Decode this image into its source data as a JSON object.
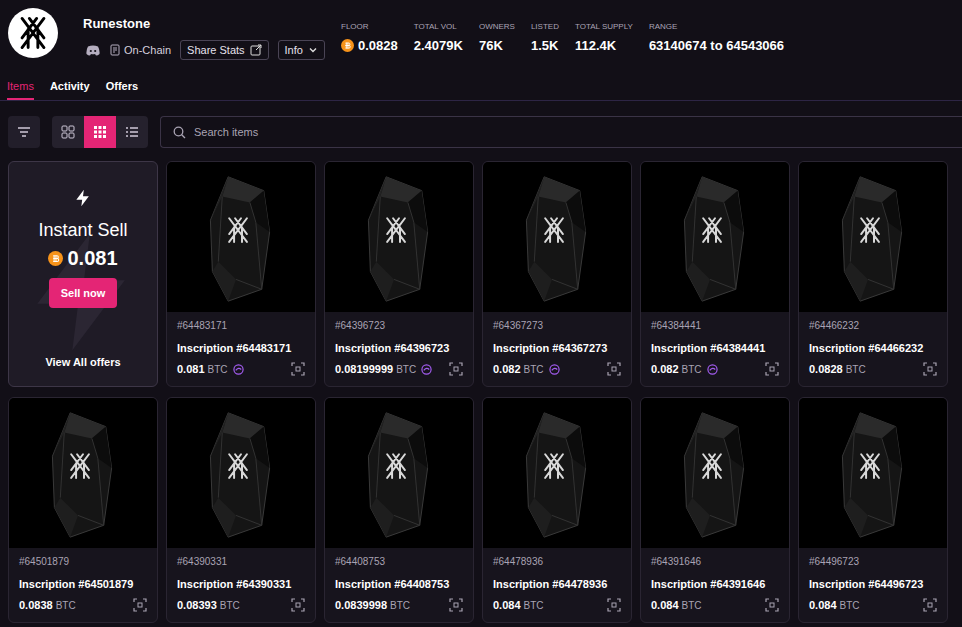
{
  "collection": {
    "name": "Runestone",
    "on_chain": "On-Chain",
    "buttons": [
      {
        "label": "Share Stats",
        "kind": "share"
      },
      {
        "label": "Info",
        "kind": "dropdown"
      }
    ]
  },
  "stats": [
    {
      "label": "FLOOR",
      "value": "0.0828",
      "btc": true
    },
    {
      "label": "TOTAL VOL",
      "value": "2.4079K",
      "btc": false
    },
    {
      "label": "OWNERS",
      "value": "76K",
      "btc": false
    },
    {
      "label": "LISTED",
      "value": "1.5K",
      "btc": false
    },
    {
      "label": "TOTAL SUPPLY",
      "value": "112.4K",
      "btc": false
    },
    {
      "label": "RANGE",
      "value": "63140674 to 64543066",
      "btc": false
    }
  ],
  "tabs": [
    {
      "label": "Items",
      "selected": true
    },
    {
      "label": "Activity",
      "selected": false
    },
    {
      "label": "Offers",
      "selected": false
    }
  ],
  "view_modes": [
    {
      "kind": "large",
      "selected": false
    },
    {
      "kind": "small",
      "selected": true
    },
    {
      "kind": "list",
      "selected": false
    }
  ],
  "search": {
    "placeholder": "Search items"
  },
  "instant_sell": {
    "title": "Instant Sell",
    "price": "0.081",
    "button": "Sell now",
    "link": "View All offers"
  },
  "items": [
    {
      "number": "#64483171",
      "name": "Inscription #64483171",
      "price": "0.081",
      "currency": "BTC",
      "badge": true
    },
    {
      "number": "#64396723",
      "name": "Inscription #64396723",
      "price": "0.08199999",
      "currency": "BTC",
      "badge": true
    },
    {
      "number": "#64367273",
      "name": "Inscription #64367273",
      "price": "0.082",
      "currency": "BTC",
      "badge": true
    },
    {
      "number": "#64384441",
      "name": "Inscription #64384441",
      "price": "0.082",
      "currency": "BTC",
      "badge": true
    },
    {
      "number": "#64466232",
      "name": "Inscription #64466232",
      "price": "0.0828",
      "currency": "BTC",
      "badge": false
    },
    {
      "number": "#64501879",
      "name": "Inscription #64501879",
      "price": "0.0838",
      "currency": "BTC",
      "badge": false
    },
    {
      "number": "#64390331",
      "name": "Inscription #64390331",
      "price": "0.08393",
      "currency": "BTC",
      "badge": false
    },
    {
      "number": "#64408753",
      "name": "Inscription #64408753",
      "price": "0.0839998",
      "currency": "BTC",
      "badge": false
    },
    {
      "number": "#64478936",
      "name": "Inscription #64478936",
      "price": "0.084",
      "currency": "BTC",
      "badge": false
    },
    {
      "number": "#64391646",
      "name": "Inscription #64391646",
      "price": "0.084",
      "currency": "BTC",
      "badge": false
    },
    {
      "number": "#64496723",
      "name": "Inscription #64496723",
      "price": "0.084",
      "currency": "BTC",
      "badge": false
    }
  ]
}
